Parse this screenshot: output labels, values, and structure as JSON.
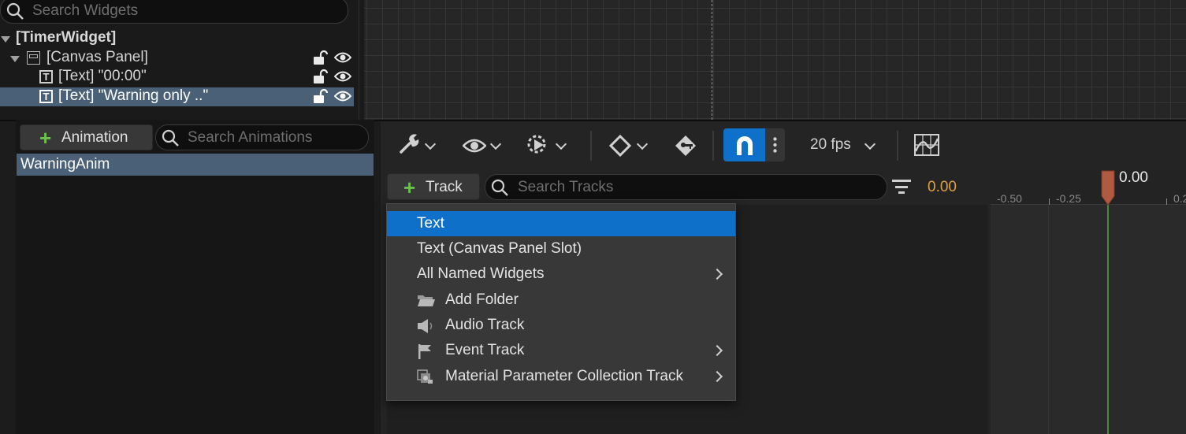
{
  "hierarchy": {
    "search_placeholder": "Search Widgets",
    "items": [
      {
        "label": "[TimerWidget]"
      },
      {
        "label": "[Canvas Panel]"
      },
      {
        "label": "[Text] \"00:00\""
      },
      {
        "label": "[Text] \"Warning only ..\""
      }
    ]
  },
  "animations": {
    "add_label": "Animation",
    "search_placeholder": "Search Animations",
    "items": [
      {
        "label": "WarningAnim"
      }
    ]
  },
  "sequencer": {
    "fps_label": "20 fps",
    "add_track_label": "Track",
    "search_placeholder": "Search Tracks",
    "current_time": "0.00",
    "playhead_time": "0.00",
    "ruler_labels": [
      "-0.50",
      "-0.25",
      "0.2"
    ]
  },
  "track_menu": {
    "items": [
      {
        "label": "Text",
        "icon": "",
        "submenu": false
      },
      {
        "label": "Text (Canvas Panel Slot)",
        "icon": "",
        "submenu": false
      },
      {
        "label": "All Named Widgets",
        "icon": "",
        "submenu": true
      },
      {
        "label": "Add Folder",
        "icon": "folder-icon",
        "submenu": false
      },
      {
        "label": "Audio Track",
        "icon": "audio-icon",
        "submenu": false
      },
      {
        "label": "Event Track",
        "icon": "flag-icon",
        "submenu": true
      },
      {
        "label": "Material Parameter Collection Track",
        "icon": "material-collection-icon",
        "submenu": true
      }
    ]
  },
  "colors": {
    "selection": "#4a6077",
    "accent_blue": "#0e70c8",
    "time_orange": "#e0a040",
    "plus_green": "#6bc24a"
  }
}
